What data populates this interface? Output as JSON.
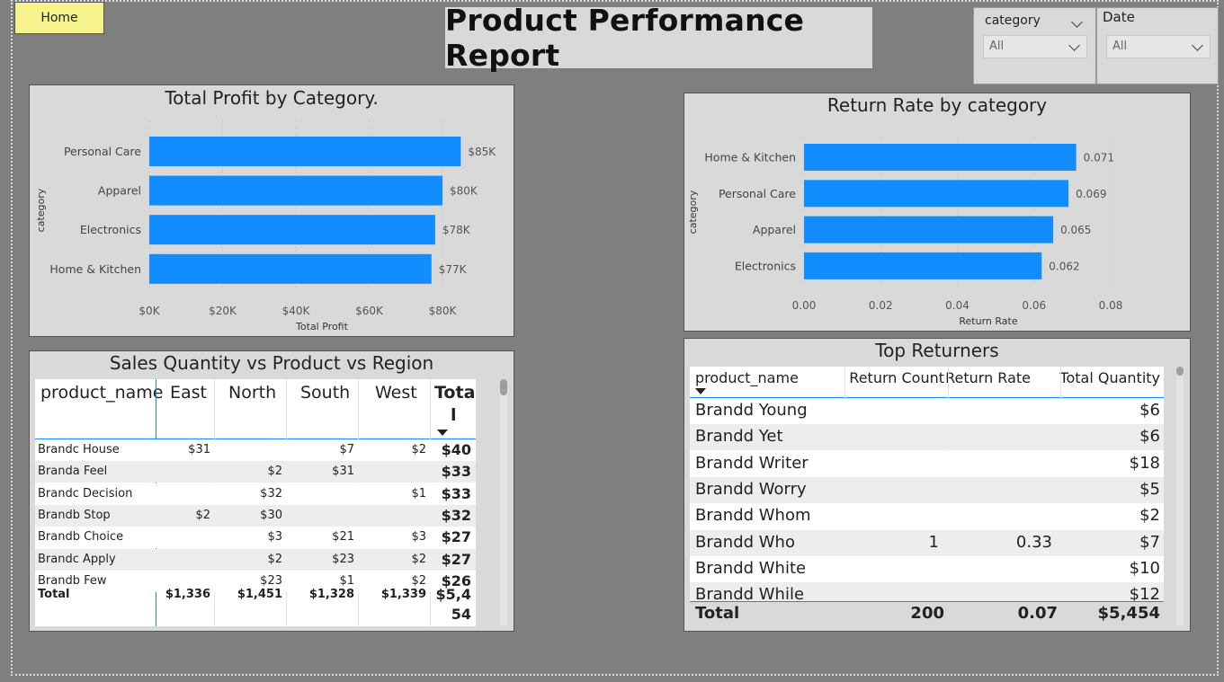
{
  "home_button": {
    "label": "Home"
  },
  "report_title": "Product Performance Report",
  "slicers": {
    "category": {
      "label": "category",
      "value": "All"
    },
    "date": {
      "label": "Date",
      "value": "All"
    }
  },
  "profit_chart": {
    "title": "Total Profit by Category.",
    "ylabel": "category",
    "xlabel": "Total Profit"
  },
  "return_chart": {
    "title": "Return Rate by category",
    "ylabel": "category",
    "xlabel": "Return Rate"
  },
  "chart_data": [
    {
      "type": "bar",
      "title": "Total Profit by Category.",
      "orientation": "horizontal",
      "xlabel": "Total Profit",
      "ylabel": "category",
      "categories": [
        "Personal Care",
        "Apparel",
        "Electronics",
        "Home & Kitchen"
      ],
      "values": [
        85000,
        80000,
        78000,
        77000
      ],
      "data_labels": [
        "$85K",
        "$80K",
        "$78K",
        "$77K"
      ],
      "xlim": [
        0,
        80000
      ],
      "ticks": [
        "$0K",
        "$20K",
        "$40K",
        "$60K",
        "$80K"
      ],
      "tick_values": [
        0,
        20000,
        40000,
        60000,
        80000
      ],
      "color": "#118dff",
      "grid": true
    },
    {
      "type": "bar",
      "title": "Return Rate by category",
      "orientation": "horizontal",
      "xlabel": "Return Rate",
      "ylabel": "category",
      "categories": [
        "Home & Kitchen",
        "Personal Care",
        "Apparel",
        "Electronics"
      ],
      "values": [
        0.071,
        0.069,
        0.065,
        0.062
      ],
      "data_labels": [
        "0.071",
        "0.069",
        "0.065",
        "0.062"
      ],
      "xlim": [
        0,
        0.08
      ],
      "ticks": [
        "0.00",
        "0.02",
        "0.04",
        "0.06",
        "0.08"
      ],
      "tick_values": [
        0,
        0.02,
        0.04,
        0.06,
        0.08
      ],
      "color": "#118dff",
      "grid": true
    }
  ],
  "matrix": {
    "title": "Sales Quantity vs Product vs Region",
    "headers": [
      "product_name",
      "East",
      "North",
      "South",
      "West",
      "Tota",
      "l"
    ],
    "rows": [
      {
        "name": "Brandc House",
        "east": "$31",
        "north": "",
        "south": "$7",
        "west": "$2",
        "total": "$40"
      },
      {
        "name": "Branda Feel",
        "east": "",
        "north": "$2",
        "south": "$31",
        "west": "",
        "total": "$33"
      },
      {
        "name": "Brandc Decision",
        "east": "",
        "north": "$32",
        "south": "",
        "west": "$1",
        "total": "$33"
      },
      {
        "name": "Brandb Stop",
        "east": "$2",
        "north": "$30",
        "south": "",
        "west": "",
        "total": "$32"
      },
      {
        "name": "Brandb Choice",
        "east": "",
        "north": "$3",
        "south": "$21",
        "west": "$3",
        "total": "$27"
      },
      {
        "name": "Brandc Apply",
        "east": "",
        "north": "$2",
        "south": "$23",
        "west": "$2",
        "total": "$27"
      },
      {
        "name": "Brandb Few",
        "east": "",
        "north": "$23",
        "south": "$1",
        "west": "$2",
        "total": "$26"
      }
    ],
    "total_row": {
      "name": "Total",
      "east": "$1,336",
      "north": "$1,451",
      "south": "$1,328",
      "west": "$1,339",
      "total_line1": "$5,4",
      "total_line2": "54"
    }
  },
  "top_returners": {
    "title": "Top Returners",
    "headers": [
      "product_name",
      "Return Count",
      "Return Rate",
      "Total Quantity"
    ],
    "rows": [
      {
        "name": "Brandd Young",
        "count": "",
        "rate": "",
        "qty": "$6"
      },
      {
        "name": "Brandd Yet",
        "count": "",
        "rate": "",
        "qty": "$6"
      },
      {
        "name": "Brandd Writer",
        "count": "",
        "rate": "",
        "qty": "$18"
      },
      {
        "name": "Brandd Worry",
        "count": "",
        "rate": "",
        "qty": "$5"
      },
      {
        "name": "Brandd Whom",
        "count": "",
        "rate": "",
        "qty": "$2"
      },
      {
        "name": "Brandd Who",
        "count": "1",
        "rate": "0.33",
        "qty": "$7"
      },
      {
        "name": "Brandd White",
        "count": "",
        "rate": "",
        "qty": "$10"
      },
      {
        "name": "Brandd While",
        "count": "",
        "rate": "",
        "qty": "$12"
      }
    ],
    "total_row": {
      "name": "Total",
      "count": "200",
      "rate": "0.07",
      "qty": "$5,454"
    }
  }
}
